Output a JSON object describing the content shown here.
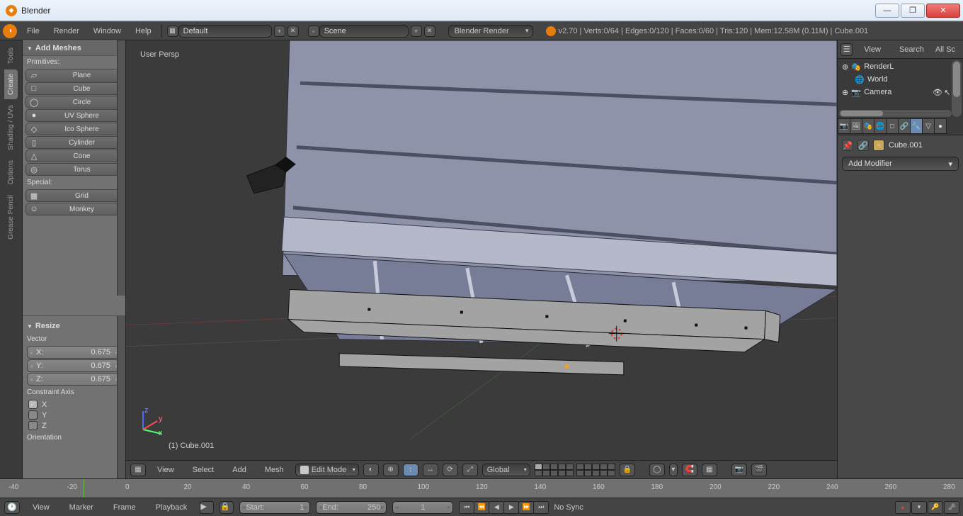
{
  "window": {
    "title": "Blender"
  },
  "header": {
    "menus": [
      "File",
      "Render",
      "Window",
      "Help"
    ],
    "layout_field": "Default",
    "scene_field": "Scene",
    "engine": "Blender Render",
    "stats": "v2.70 | Verts:0/64 | Edges:0/120 | Faces:0/60 | Tris:120 | Mem:12.58M (0.11M) | Cube.001"
  },
  "side_tabs": [
    "Tools",
    "Create",
    "Shading / UVs",
    "Options",
    "Grease Pencil"
  ],
  "tool_panel": {
    "title": "Add Meshes",
    "primitives_label": "Primitives:",
    "primitives": [
      "Plane",
      "Cube",
      "Circle",
      "UV Sphere",
      "Ico Sphere",
      "Cylinder",
      "Cone",
      "Torus"
    ],
    "special_label": "Special:",
    "special": [
      "Grid",
      "Monkey"
    ]
  },
  "operator_panel": {
    "title": "Resize",
    "vector_label": "Vector",
    "x_label": "X:",
    "y_label": "Y:",
    "z_label": "Z:",
    "x_val": "0.675",
    "y_val": "0.675",
    "z_val": "0.675",
    "constraint_label": "Constraint Axis",
    "cx": "X",
    "cy": "Y",
    "cz": "Z",
    "orientation_label": "Orientation"
  },
  "viewport": {
    "top_label": "User Persp",
    "bottom_label": "(1) Cube.001"
  },
  "viewport_header": {
    "view": "View",
    "select": "Select",
    "add": "Add",
    "mesh": "Mesh",
    "mode": "Edit Mode",
    "orient": "Global"
  },
  "timeline_header": {
    "view": "View",
    "marker": "Marker",
    "frame": "Frame",
    "playback": "Playback",
    "start_lbl": "Start:",
    "start_val": "1",
    "end_lbl": "End:",
    "end_val": "250",
    "cur_val": "1",
    "sync": "No Sync"
  },
  "timeline_ticks": [
    "-40",
    "-20",
    "0",
    "20",
    "40",
    "60",
    "80",
    "100",
    "120",
    "140",
    "160",
    "180",
    "200",
    "220",
    "240",
    "260",
    "280"
  ],
  "outliner": {
    "view": "View",
    "search": "Search",
    "all": "All Sc",
    "items": [
      {
        "label": "RenderL",
        "icon": "scene"
      },
      {
        "label": "World",
        "icon": "world"
      },
      {
        "label": "Camera",
        "icon": "camera"
      }
    ]
  },
  "properties": {
    "crumb_obj": "Cube.001",
    "add_modifier": "Add Modifier"
  }
}
